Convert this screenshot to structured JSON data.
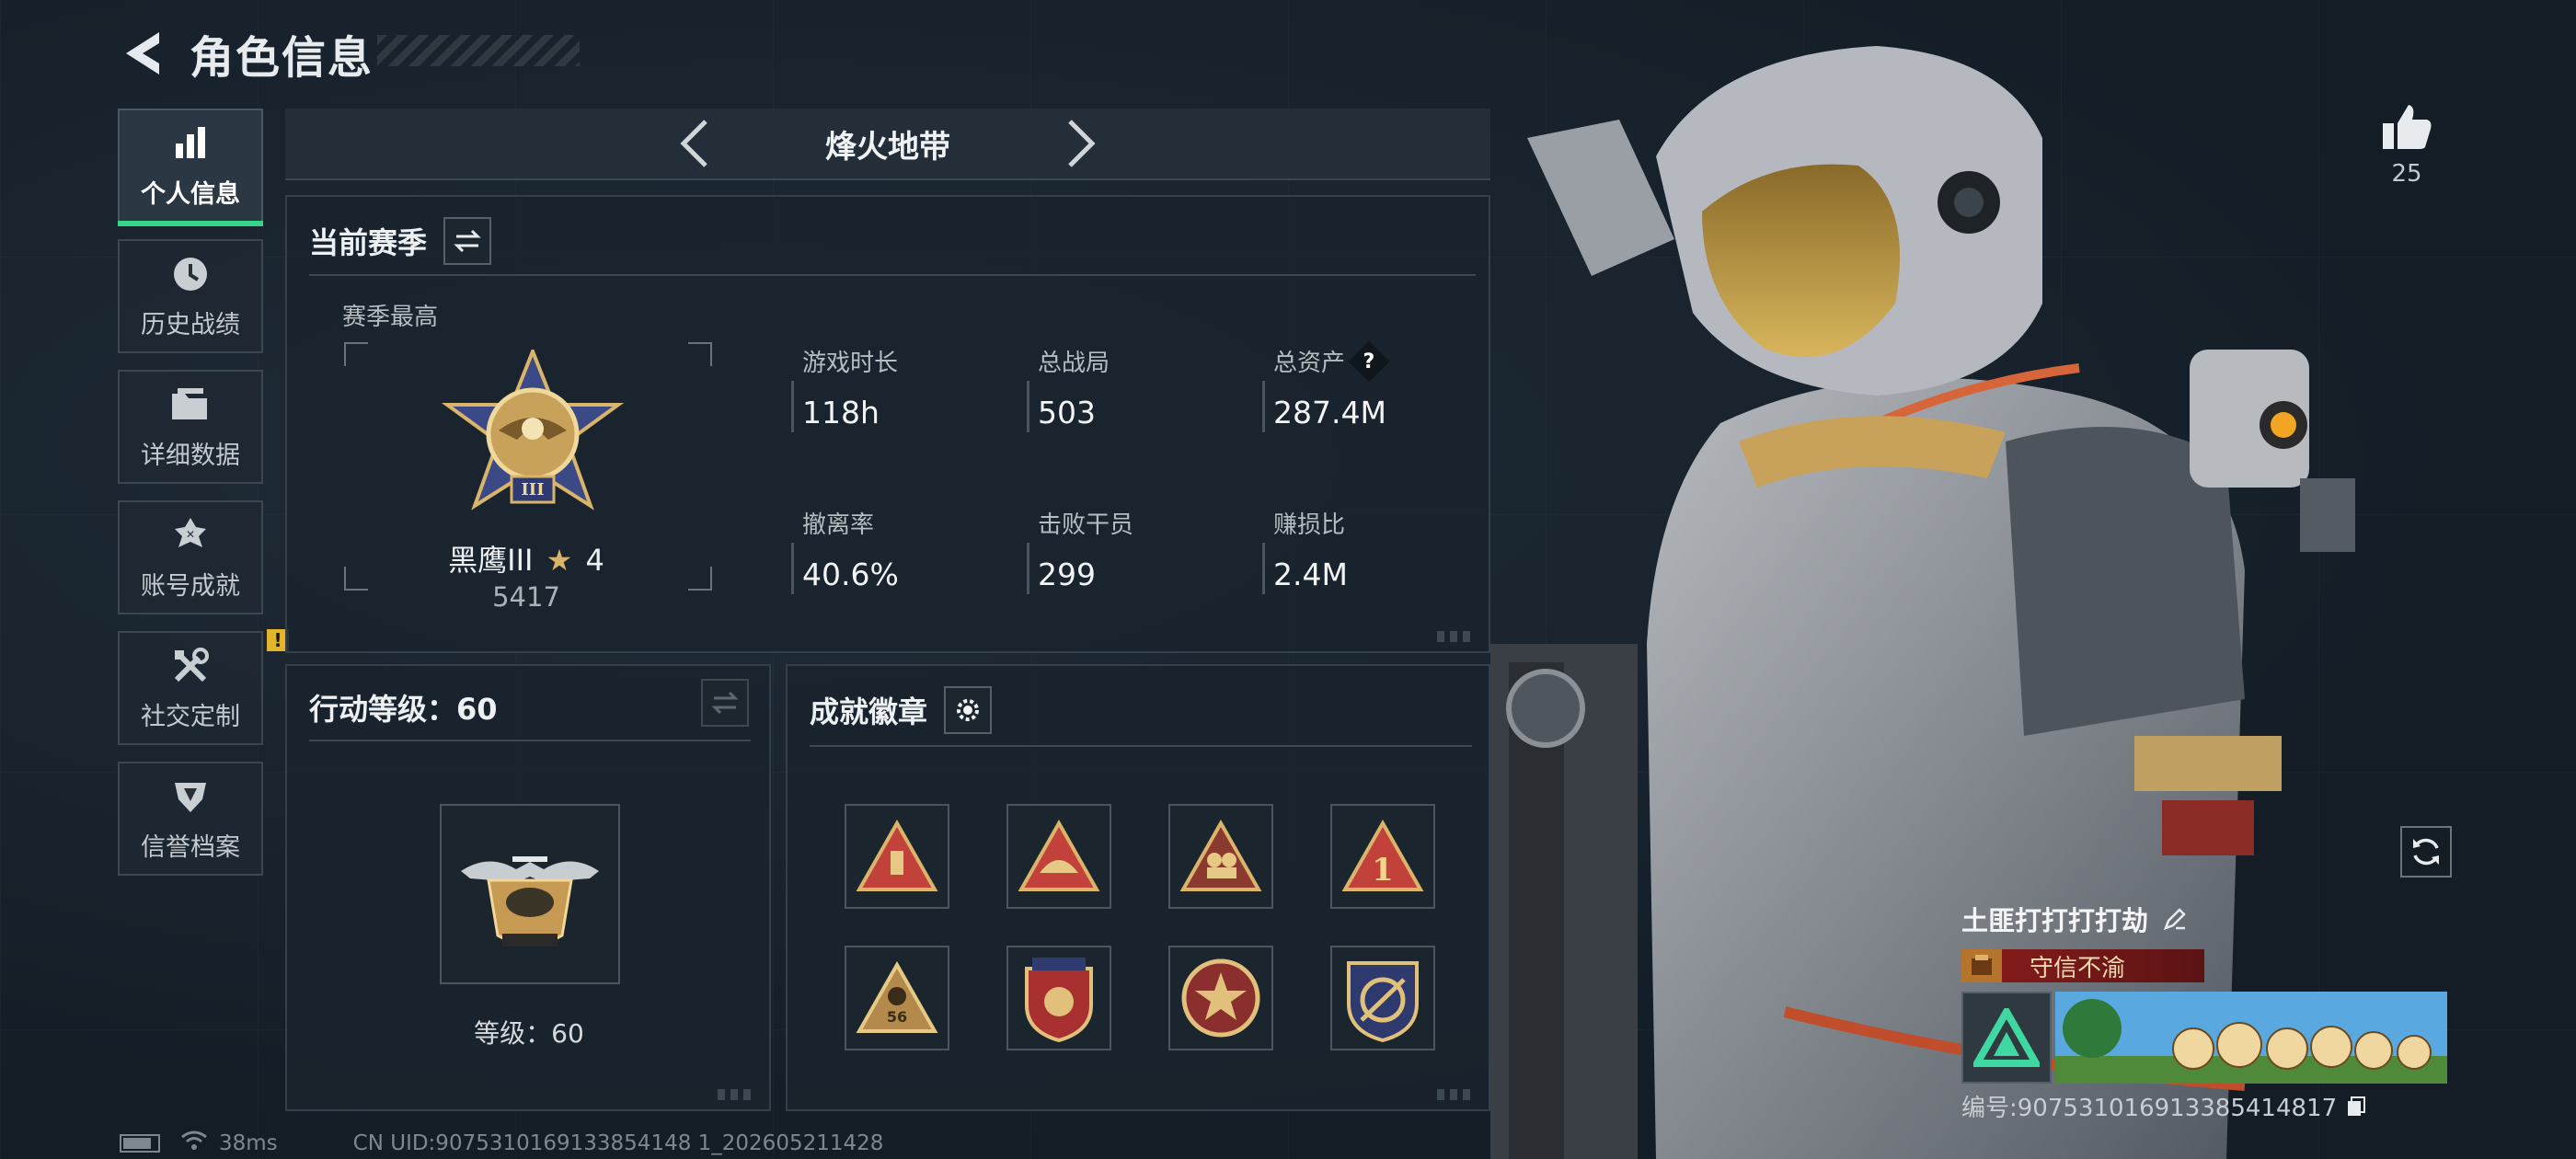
{
  "header": {
    "title": "角色信息"
  },
  "sidebar": {
    "items": [
      {
        "label": "个人信息",
        "icon": "bar-chart-icon",
        "active": true
      },
      {
        "label": "历史战绩",
        "icon": "clock-icon"
      },
      {
        "label": "详细数据",
        "icon": "folder-icon"
      },
      {
        "label": "账号成就",
        "icon": "achievement-icon"
      },
      {
        "label": "社交定制",
        "icon": "tools-icon",
        "badge": "!"
      },
      {
        "label": "信誉档案",
        "icon": "credit-icon"
      }
    ]
  },
  "mode": {
    "title": "烽火地带"
  },
  "season": {
    "title": "当前赛季",
    "best_label": "赛季最高",
    "rank_name": "黑鹰III",
    "rank_stars": "4",
    "rank_points": "5417",
    "stats": [
      {
        "label": "游戏时长",
        "value": "118h"
      },
      {
        "label": "总战局",
        "value": "503"
      },
      {
        "label": "总资产",
        "value": "287.4M",
        "help": "?"
      },
      {
        "label": "撤离率",
        "value": "40.6%"
      },
      {
        "label": "击败干员",
        "value": "299"
      },
      {
        "label": "赚损比",
        "value": "2.4M"
      }
    ]
  },
  "action_level": {
    "title": "行动等级：60",
    "level_label": "等级：60"
  },
  "achievements": {
    "title": "成就徽章"
  },
  "likes": {
    "count": "25"
  },
  "player": {
    "name": "土匪打打打打劫",
    "honor": "守信不渝",
    "id_text": "编号:907531016913385414817"
  },
  "status": {
    "ping": "38ms",
    "uid": "CN UID:9075310169133854148 1_202605211428"
  },
  "colors": {
    "accent_green": "#36d68a",
    "alert_yellow": "#e2b52a",
    "honor_red": "#8a1c1c"
  }
}
